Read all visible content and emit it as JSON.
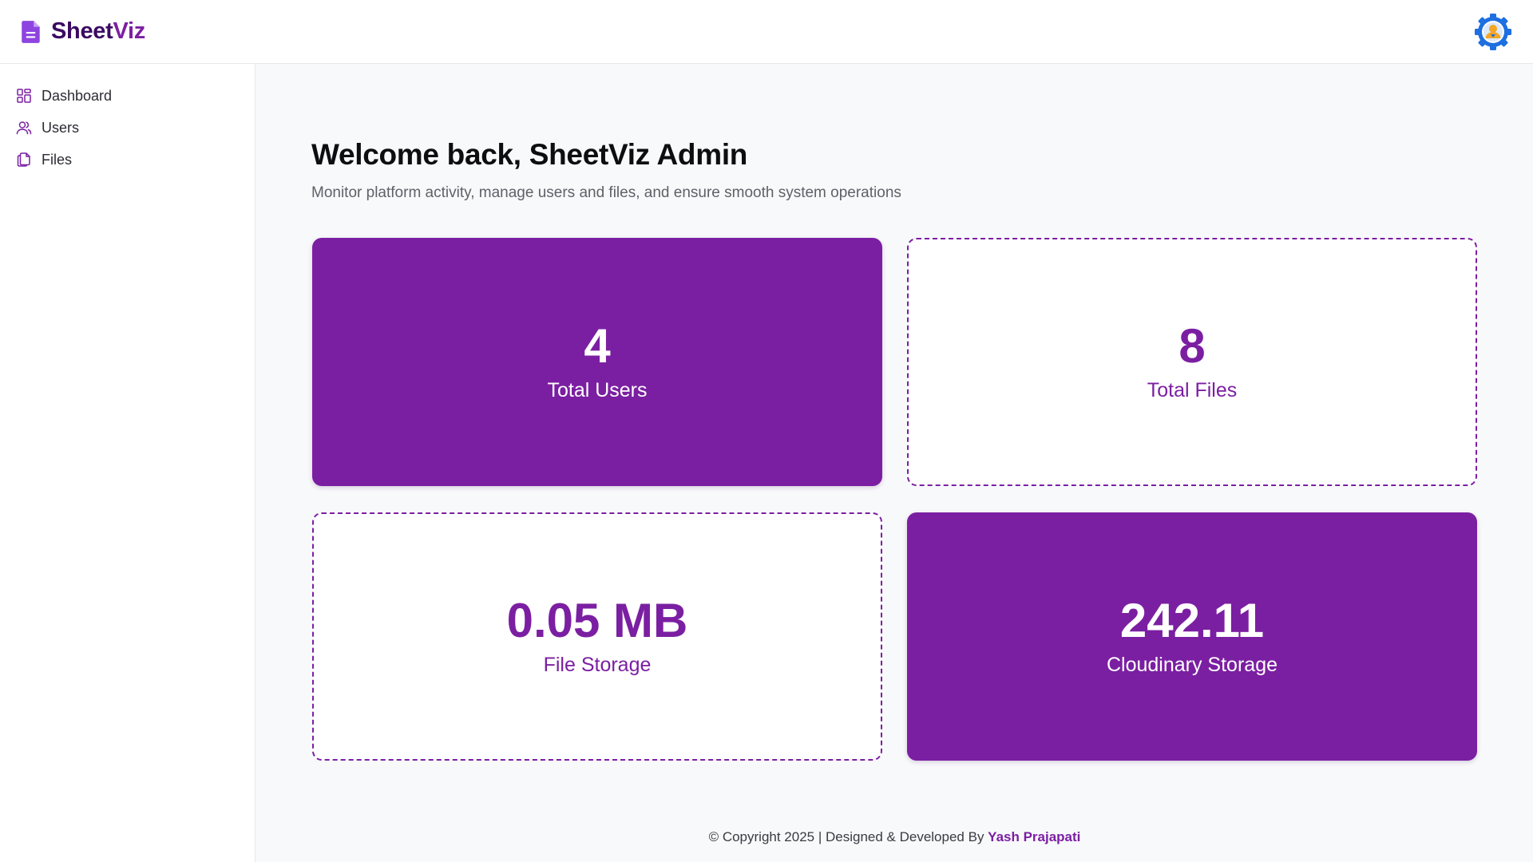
{
  "header": {
    "brand_part1": "Sheet",
    "brand_part2": "Viz",
    "brand_icon": "document-icon",
    "avatar_icon": "user-gear-avatar-icon"
  },
  "sidebar": {
    "items": [
      {
        "label": "Dashboard",
        "icon": "grid-icon"
      },
      {
        "label": "Users",
        "icon": "users-icon"
      },
      {
        "label": "Files",
        "icon": "files-icon"
      }
    ]
  },
  "main": {
    "title": "Welcome back, SheetViz Admin",
    "subtitle": "Monitor platform activity, manage users and files, and ensure smooth system operations",
    "cards": [
      {
        "value": "4",
        "caption": "Total Users",
        "style": "filled"
      },
      {
        "value": "8",
        "caption": "Total Files",
        "style": "outline"
      },
      {
        "value": "0.05 MB",
        "caption": "File Storage",
        "style": "outline"
      },
      {
        "value": "242.11",
        "caption": "Cloudinary Storage",
        "style": "filled"
      }
    ]
  },
  "footer": {
    "text": "© Copyright 2025 | Designed & Developed By ",
    "author": "Yash Prajapati"
  },
  "colors": {
    "accent": "#7b1fa2",
    "brand_dark": "#3b0a63",
    "background": "#f8f9fb",
    "avatar_blue": "#1e6fe0",
    "avatar_orange": "#f5a623"
  }
}
